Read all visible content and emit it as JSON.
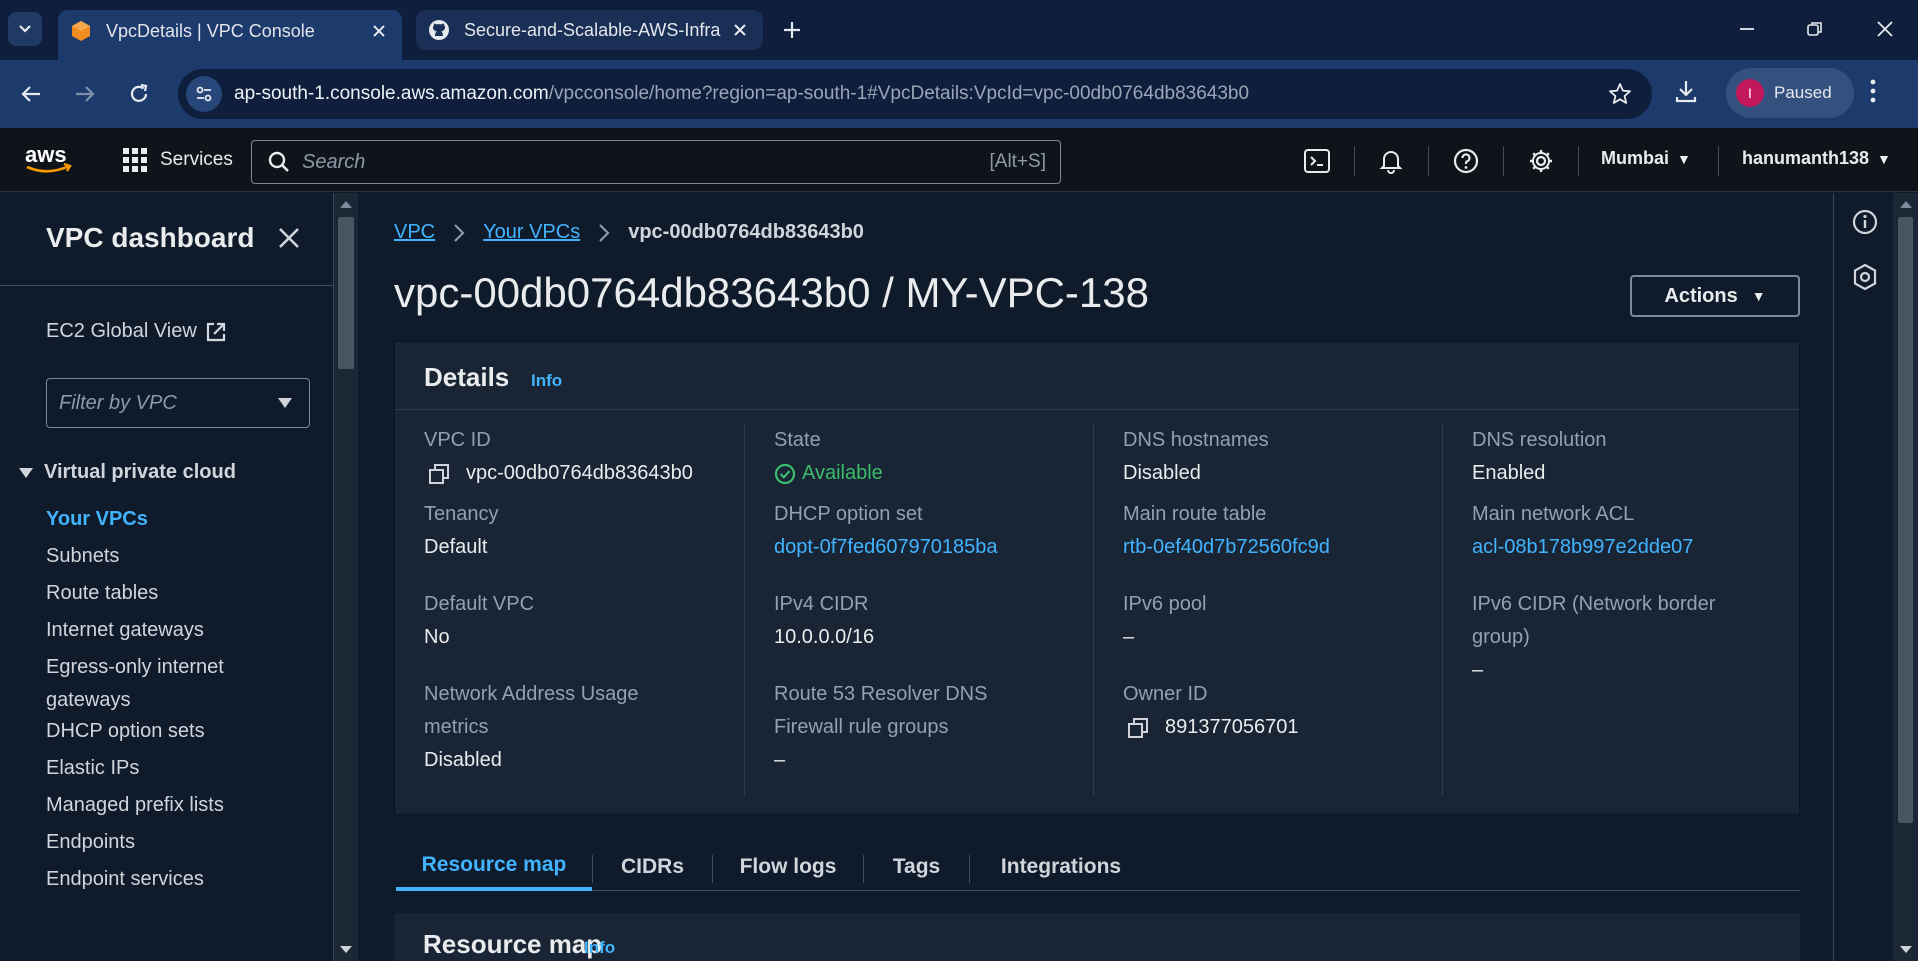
{
  "browser": {
    "tabs": [
      {
        "title": "VpcDetails | VPC Console",
        "active": true
      },
      {
        "title": "Secure-and-Scalable-AWS-Infra",
        "active": false
      }
    ],
    "url_host": "ap-south-1.console.aws.amazon.com",
    "url_path": "/vpcconsole/home?region=ap-south-1#VpcDetails:VpcId=vpc-00db0764db83643b0",
    "profile_initial": "I",
    "profile_label": "Paused"
  },
  "aws_header": {
    "logo_text": "aws",
    "services_label": "Services",
    "search_placeholder": "Search",
    "search_shortcut": "[Alt+S]",
    "region": "Mumbai",
    "account": "hanumanth138"
  },
  "sidebar": {
    "title": "VPC dashboard",
    "global_view": "EC2 Global View",
    "filter_placeholder": "Filter by VPC",
    "section": "Virtual private cloud",
    "items": [
      {
        "label": "Your VPCs",
        "active": true
      },
      {
        "label": "Subnets"
      },
      {
        "label": "Route tables"
      },
      {
        "label": "Internet gateways"
      },
      {
        "label": "Egress-only internet gateways"
      },
      {
        "label": "DHCP option sets"
      },
      {
        "label": "Elastic IPs"
      },
      {
        "label": "Managed prefix lists"
      },
      {
        "label": "Endpoints"
      },
      {
        "label": "Endpoint services"
      }
    ]
  },
  "breadcrumb": {
    "items": [
      "VPC",
      "Your VPCs"
    ],
    "current": "vpc-00db0764db83643b0"
  },
  "page_title": "vpc-00db0764db83643b0 / MY-VPC-138",
  "actions_label": "Actions",
  "details": {
    "heading": "Details",
    "info": "Info",
    "columns": [
      [
        {
          "label": "VPC ID",
          "value": "vpc-00db0764db83643b0",
          "copy": true
        },
        {
          "label": "Tenancy",
          "value": "Default"
        },
        {
          "label": "Default VPC",
          "value": "No"
        },
        {
          "label": "Network Address Usage metrics",
          "value": "Disabled"
        }
      ],
      [
        {
          "label": "State",
          "value": "Available",
          "status": "ok"
        },
        {
          "label": "DHCP option set",
          "value": "dopt-0f7fed607970185ba",
          "link": true
        },
        {
          "label": "IPv4 CIDR",
          "value": "10.0.0.0/16"
        },
        {
          "label": "Route 53 Resolver DNS Firewall rule groups",
          "value": "–"
        }
      ],
      [
        {
          "label": "DNS hostnames",
          "value": "Disabled"
        },
        {
          "label": "Main route table",
          "value": "rtb-0ef40d7b72560fc9d",
          "link": true
        },
        {
          "label": "IPv6 pool",
          "value": "–"
        },
        {
          "label": "Owner ID",
          "value": "891377056701",
          "copy": true
        }
      ],
      [
        {
          "label": "DNS resolution",
          "value": "Enabled"
        },
        {
          "label": "Main network ACL",
          "value": "acl-08b178b997e2dde07",
          "link": true
        },
        {
          "label": "IPv6 CIDR (Network border group)",
          "value": "–"
        }
      ]
    ]
  },
  "detail_tabs": [
    "Resource map",
    "CIDRs",
    "Flow logs",
    "Tags",
    "Integrations"
  ],
  "resource_map": {
    "heading": "Resource map",
    "info": "Info"
  },
  "colors": {
    "accent": "#42b4ff",
    "success": "#3dbb6c",
    "background": "#0f1b2a",
    "panel": "#192534"
  }
}
